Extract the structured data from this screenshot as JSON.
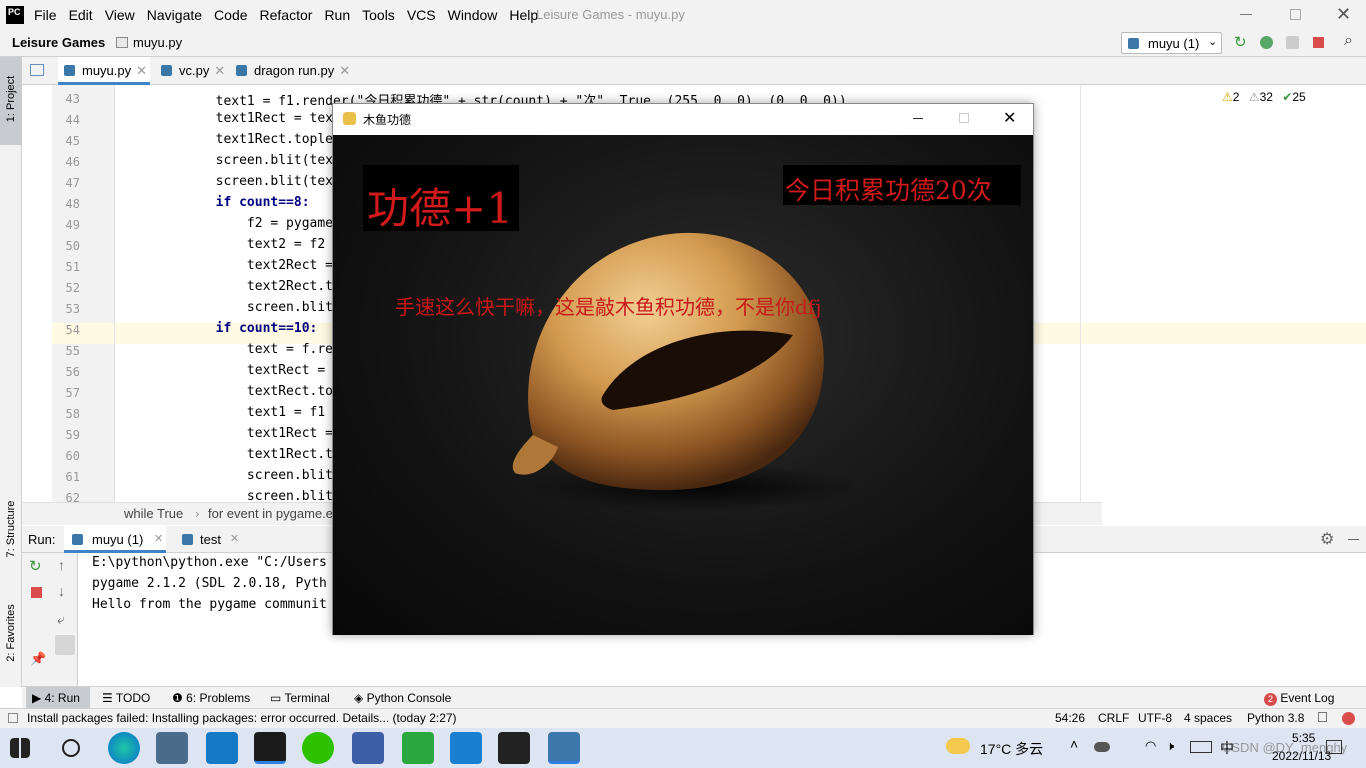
{
  "ide": {
    "logo": "PC",
    "menu": [
      "File",
      "Edit",
      "View",
      "Navigate",
      "Code",
      "Refactor",
      "Run",
      "Tools",
      "VCS",
      "Window",
      "Help"
    ],
    "window_title": "Leisure Games - muyu.py",
    "project": "Leisure Games",
    "file": "muyu.py",
    "run_config": "muyu (1)",
    "tabs": [
      "muyu.py",
      "vc.py",
      "dragon run.py"
    ],
    "inspections": {
      "warnings": "2",
      "weak": "32",
      "ok": "25"
    },
    "side_tools": {
      "project": "1: Project",
      "structure": "7: Structure",
      "favorites": "2: Favorites"
    }
  },
  "code": {
    "line_numbers": [
      "43",
      "44",
      "45",
      "46",
      "47",
      "48",
      "49",
      "50",
      "51",
      "52",
      "53",
      "54",
      "55",
      "56",
      "57",
      "58",
      "59",
      "60",
      "61",
      "62"
    ],
    "lines": [
      "        text1 = f1.render(\"今日积累功德\" + str(count) + \"次\", True, (255, 0, 0), (0, 0, 0))",
      "        text1Rect = tex",
      "        text1Rect.tople",
      "        screen.blit(tex",
      "        screen.blit(tex",
      "        if count==8:",
      "            f2 = pygame",
      "            text2 = f2",
      "            text2Rect =",
      "            text2Rect.t",
      "            screen.blit",
      "        if count==10:",
      "            text = f.re",
      "            textRect =",
      "            textRect.to",
      "            text1 = f1",
      "            text1Rect =",
      "            text1Rect.t",
      "            screen.blit",
      "            screen.blit"
    ],
    "breadcrumb": [
      "while True",
      "for event in pygame.e"
    ]
  },
  "run": {
    "label": "Run:",
    "tabs": [
      "muyu (1)",
      "test"
    ],
    "output": [
      "E:\\python\\python.exe \"C:/Users",
      "pygame 2.1.2 (SDL 2.0.18, Pyth",
      "Hello from the pygame communit"
    ]
  },
  "bottom_tools": [
    "4: Run",
    "TODO",
    "6: Problems",
    "Terminal",
    "Python Console"
  ],
  "event_log": {
    "label": "Event Log",
    "count": "2"
  },
  "status": {
    "message": "Install packages failed: Installing packages: error occurred. Details... (today 2:27)",
    "position": "54:26",
    "line_sep": "CRLF",
    "encoding": "UTF-8",
    "indent": "4 spaces",
    "interpreter": "Python 3.8"
  },
  "game": {
    "title": "木鱼功德",
    "merit": "功德+1",
    "counter": "今日积累功德20次",
    "message": "手速这么快干嘛，这是敲木鱼积功德，不是你dfj"
  },
  "taskbar": {
    "weather": "17°C 多云",
    "ime": "中",
    "time": "5:35",
    "date": "2022/11/13",
    "watermark": "CSDN @DY_menghy"
  }
}
